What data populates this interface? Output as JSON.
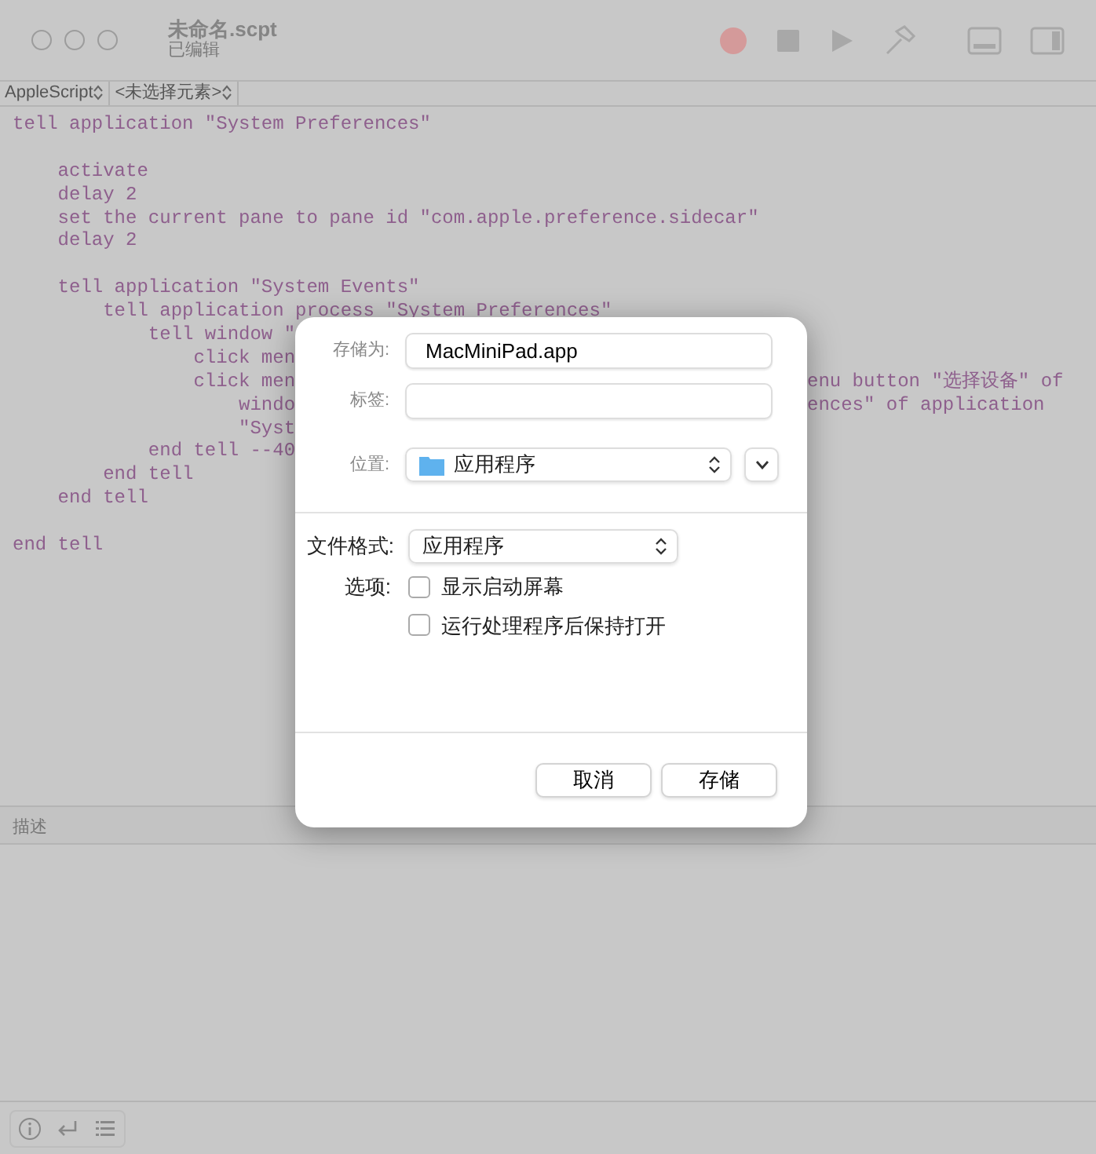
{
  "window": {
    "title": "未命名.scpt",
    "subtitle": "已编辑"
  },
  "navigator": {
    "language": "AppleScript",
    "element": "<未选择元素>"
  },
  "code_lines": [
    {
      "text": "tell application \"System Preferences\""
    },
    {
      "kind": "blank"
    },
    {
      "text": "    activate"
    },
    {
      "text": "    delay 2"
    },
    {
      "text": "    set the current pane to pane id \"com.apple.preference.sidecar\""
    },
    {
      "text": "    delay 2"
    },
    {
      "kind": "blank"
    },
    {
      "text": "    tell application \"System Events\""
    },
    {
      "text": "        tell application process \"System Preferences\""
    },
    {
      "text": "            tell window \""
    },
    {
      "text": "                click men"
    },
    {
      "text": "                click men",
      "tail": "enu button \"选择设备\" of"
    },
    {
      "text": "                    windo",
      "tail": "ences\" of application"
    },
    {
      "text": "                    \"Syst"
    },
    {
      "text": "            end tell --40"
    },
    {
      "text": "        end tell"
    },
    {
      "text": "    end tell"
    },
    {
      "kind": "blank"
    },
    {
      "text": "end tell"
    }
  ],
  "description_bar": {
    "label": "描述"
  },
  "save_dialog": {
    "save_as": {
      "label": "存储为:",
      "value": "MacMiniPad.app"
    },
    "tags": {
      "label": "标签:"
    },
    "location": {
      "label": "位置:",
      "value": "应用程序",
      "expanded": false
    },
    "file_format": {
      "label": "文件格式:",
      "value": "应用程序"
    },
    "options": {
      "label": "选项:",
      "items": [
        {
          "label": "显示启动屏幕",
          "checked": false
        },
        {
          "label": "运行处理程序后保持打开",
          "checked": false
        }
      ]
    },
    "buttons": [
      {
        "label": "取消"
      },
      {
        "label": "存储"
      }
    ]
  }
}
